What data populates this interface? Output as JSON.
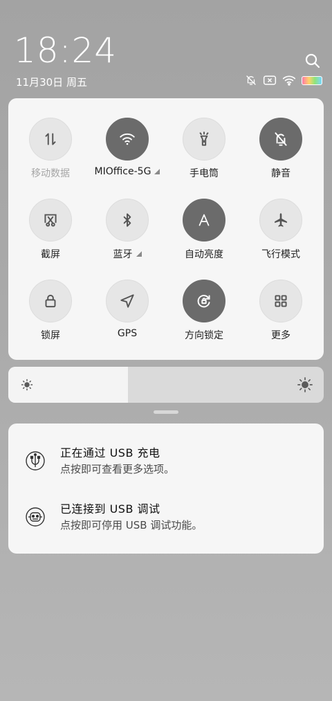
{
  "status": {
    "time": "18:24",
    "date": "11月30日 周五"
  },
  "quick_settings": [
    {
      "label": "移动数据",
      "icon": "mobile-data-icon",
      "on": false,
      "dim": true,
      "arrow": false
    },
    {
      "label": "MIOffice-5G",
      "icon": "wifi-icon",
      "on": true,
      "dim": false,
      "arrow": true
    },
    {
      "label": "手电筒",
      "icon": "flashlight-icon",
      "on": false,
      "dim": false,
      "arrow": false
    },
    {
      "label": "静音",
      "icon": "mute-icon",
      "on": true,
      "dim": false,
      "arrow": false
    },
    {
      "label": "截屏",
      "icon": "screenshot-icon",
      "on": false,
      "dim": false,
      "arrow": false
    },
    {
      "label": "蓝牙",
      "icon": "bluetooth-icon",
      "on": false,
      "dim": false,
      "arrow": true
    },
    {
      "label": "自动亮度",
      "icon": "auto-brightness-icon",
      "on": true,
      "dim": false,
      "arrow": false
    },
    {
      "label": "飞行模式",
      "icon": "airplane-icon",
      "on": false,
      "dim": false,
      "arrow": false
    },
    {
      "label": "锁屏",
      "icon": "lock-icon",
      "on": false,
      "dim": false,
      "arrow": false
    },
    {
      "label": "GPS",
      "icon": "gps-icon",
      "on": false,
      "dim": false,
      "arrow": false
    },
    {
      "label": "方向锁定",
      "icon": "rotation-lock-icon",
      "on": true,
      "dim": false,
      "arrow": false
    },
    {
      "label": "更多",
      "icon": "more-grid-icon",
      "on": false,
      "dim": false,
      "arrow": false
    }
  ],
  "brightness": {
    "level": 0.38
  },
  "notifications": [
    {
      "title": "正在通过 USB 充电",
      "subtitle": "点按即可查看更多选项。",
      "icon": "usb-icon"
    },
    {
      "title": "已连接到 USB 调试",
      "subtitle": "点按即可停用 USB 调试功能。",
      "icon": "android-debug-icon"
    }
  ],
  "colors": {
    "tile_on": "#6b6b6b",
    "tile_off": "#e6e6e6",
    "panel": "#f6f6f6"
  }
}
